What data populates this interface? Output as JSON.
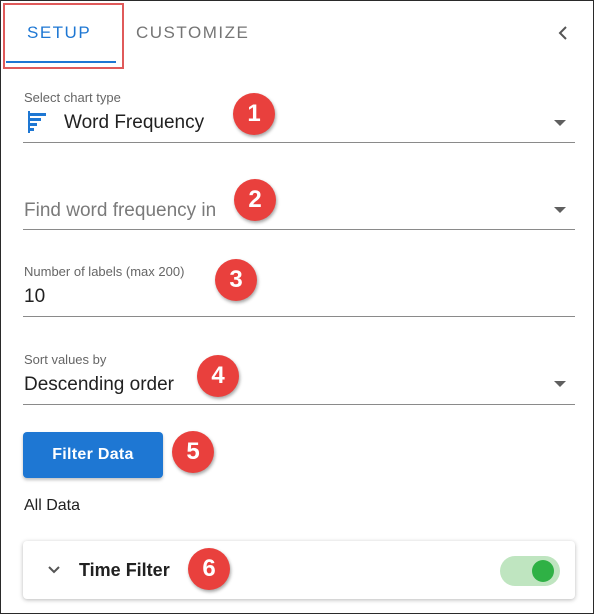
{
  "tabs": [
    {
      "label": "SETUP",
      "active": true
    },
    {
      "label": "CUSTOMIZE",
      "active": false
    }
  ],
  "colors": {
    "accent": "#1e77d3",
    "badge": "#e9403d",
    "toggle_on": "#2fb145",
    "highlight_border": "#e05a5a"
  },
  "chart_type": {
    "label": "Select chart type",
    "icon": "bar-chart-icon",
    "value": "Word Frequency",
    "badge": "1"
  },
  "word_frequency_source": {
    "placeholder": "Find word frequency in",
    "value": "",
    "badge": "2"
  },
  "label_count": {
    "label": "Number of labels (max 200)",
    "value": "10",
    "badge": "3"
  },
  "sort": {
    "label": "Sort values by",
    "value": "Descending order",
    "badge": "4"
  },
  "filter": {
    "button_label": "Filter Data",
    "badge": "5",
    "summary": "All Data"
  },
  "time_filter": {
    "label": "Time Filter",
    "enabled": true,
    "badge": "6"
  }
}
